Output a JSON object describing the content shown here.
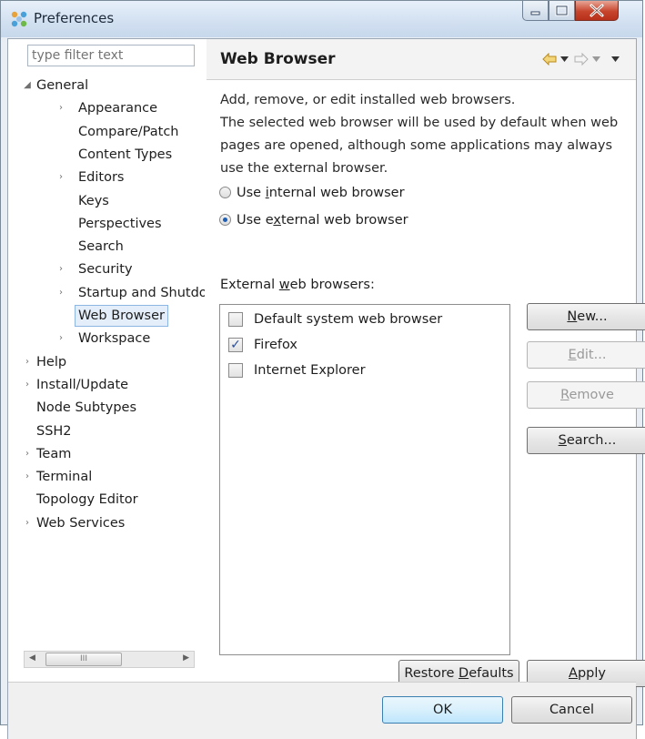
{
  "window": {
    "title": "Preferences"
  },
  "filter": {
    "placeholder": "type filter text"
  },
  "tree": [
    {
      "label": "General",
      "twisty": "◢",
      "level": 0
    },
    {
      "label": "Appearance",
      "twisty": "›",
      "level": 1
    },
    {
      "label": "Compare/Patch",
      "twisty": "",
      "level": 1
    },
    {
      "label": "Content Types",
      "twisty": "",
      "level": 1
    },
    {
      "label": "Editors",
      "twisty": "›",
      "level": 1
    },
    {
      "label": "Keys",
      "twisty": "",
      "level": 1
    },
    {
      "label": "Perspectives",
      "twisty": "",
      "level": 1
    },
    {
      "label": "Search",
      "twisty": "",
      "level": 1
    },
    {
      "label": "Security",
      "twisty": "›",
      "level": 1
    },
    {
      "label": "Startup and Shutdown",
      "twisty": "›",
      "level": 1
    },
    {
      "label": "Web Browser",
      "twisty": "",
      "level": 1,
      "selected": true
    },
    {
      "label": "Workspace",
      "twisty": "›",
      "level": 1
    },
    {
      "label": "Help",
      "twisty": "›",
      "level": 0
    },
    {
      "label": "Install/Update",
      "twisty": "›",
      "level": 0
    },
    {
      "label": "Node Subtypes",
      "twisty": "",
      "level": 0
    },
    {
      "label": "SSH2",
      "twisty": "",
      "level": 0
    },
    {
      "label": "Team",
      "twisty": "›",
      "level": 0
    },
    {
      "label": "Terminal",
      "twisty": "›",
      "level": 0
    },
    {
      "label": "Topology Editor",
      "twisty": "",
      "level": 0
    },
    {
      "label": "Web Services",
      "twisty": "›",
      "level": 0
    }
  ],
  "page": {
    "title": "Web Browser",
    "description": "Add, remove, or edit installed web browsers.\nThe selected web browser will be used by default when web pages are opened, although some applications may always use the external browser.",
    "radio_internal": {
      "pre": "Use ",
      "accel": "i",
      "post": "nternal web browser",
      "checked": false
    },
    "radio_external": {
      "pre": "Use e",
      "accel": "x",
      "post": "ternal web browser",
      "checked": true
    },
    "external_label": {
      "pre": "External ",
      "accel": "w",
      "post": "eb browsers:"
    },
    "browsers": [
      {
        "label": "Default system web browser",
        "checked": false
      },
      {
        "label": "Firefox",
        "checked": true
      },
      {
        "label": "Internet Explorer",
        "checked": false
      }
    ],
    "buttons": {
      "new": {
        "accel": "N",
        "post": "ew..."
      },
      "edit": {
        "accel": "E",
        "post": "dit..."
      },
      "remove": {
        "accel": "R",
        "post": "emove"
      },
      "search": {
        "accel": "S",
        "post": "earch..."
      },
      "restore": {
        "pre": "Restore ",
        "accel": "D",
        "post": "efaults"
      },
      "apply": {
        "accel": "A",
        "post": "pply"
      }
    }
  },
  "dialog": {
    "ok": "OK",
    "cancel": "Cancel"
  },
  "scroll": {
    "grip": "III"
  },
  "icons": {
    "nav_back": "back-arrow-icon",
    "nav_forward": "forward-arrow-icon",
    "app": "preferences-icon"
  },
  "colors": {
    "selection_bg": "#e4eefb",
    "close_button": "#c7442c",
    "radio_dot": "#1c5fb5"
  }
}
